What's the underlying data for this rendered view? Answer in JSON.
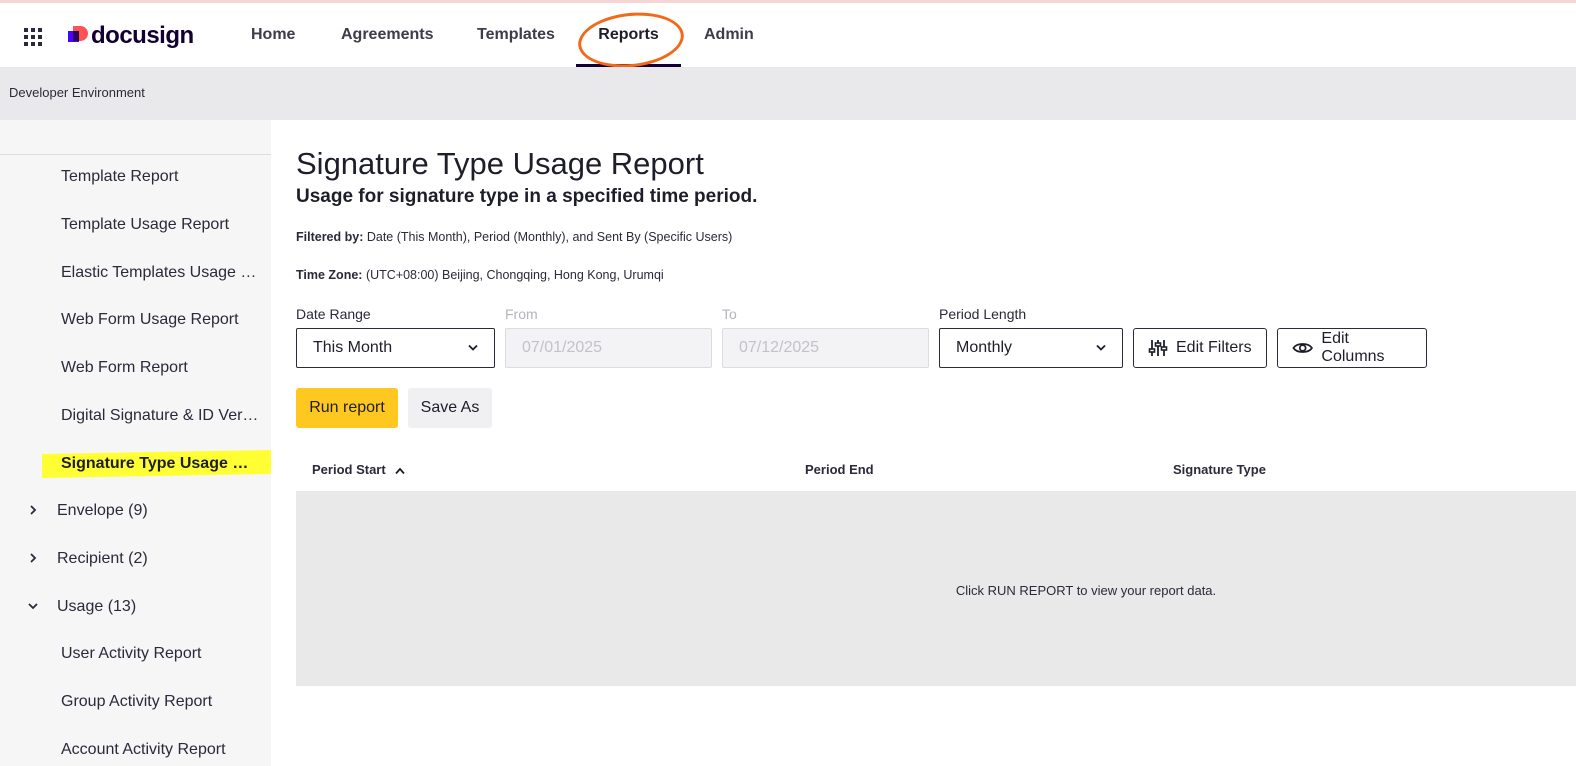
{
  "header": {
    "logo_text": "docusign",
    "nav": [
      {
        "label": "Home"
      },
      {
        "label": "Agreements"
      },
      {
        "label": "Templates"
      },
      {
        "label": "Reports"
      },
      {
        "label": "Admin"
      }
    ],
    "active_nav": "Reports"
  },
  "environment_label": "Developer Environment",
  "sidebar": {
    "items": [
      {
        "label": "Template Report"
      },
      {
        "label": "Template Usage Report"
      },
      {
        "label": "Elastic Templates Usage R..."
      },
      {
        "label": "Web Form Usage Report"
      },
      {
        "label": "Web Form Report"
      },
      {
        "label": "Digital Signature & ID Veri..."
      },
      {
        "label": "Signature Type Usage Re..."
      }
    ],
    "groups": [
      {
        "label": "Envelope (9)",
        "expanded": false
      },
      {
        "label": "Recipient (2)",
        "expanded": false
      },
      {
        "label": "Usage (13)",
        "expanded": true
      }
    ],
    "usage_items": [
      {
        "label": "User Activity Report"
      },
      {
        "label": "Group Activity Report"
      },
      {
        "label": "Account Activity Report"
      }
    ]
  },
  "report": {
    "title": "Signature Type Usage Report",
    "subtitle": "Usage for signature type in a specified time period.",
    "filtered_by_label": "Filtered by:",
    "filtered_by_value": "Date (This Month), Period (Monthly), and Sent By (Specific Users)",
    "timezone_label": "Time Zone:",
    "timezone_value": "(UTC+08:00) Beijing, Chongqing, Hong Kong, Urumqi"
  },
  "filters": {
    "date_range_label": "Date Range",
    "date_range_value": "This Month",
    "from_label": "From",
    "from_value": "07/01/2025",
    "to_label": "To",
    "to_value": "07/12/2025",
    "period_length_label": "Period Length",
    "period_length_value": "Monthly",
    "edit_filters_label": "Edit Filters",
    "edit_columns_label": "Edit Columns"
  },
  "actions": {
    "run_report_label": "Run report",
    "save_as_label": "Save As"
  },
  "table": {
    "columns": [
      "Period Start",
      "Period End",
      "Signature Type"
    ],
    "empty_message": "Click RUN REPORT to view your report data."
  },
  "colors": {
    "accent_yellow": "#ffc820",
    "highlight": "#ffff33",
    "annotation_orange": "#f06a1a",
    "brand_purple": "#4c00ff",
    "brand_coral": "#ff5252"
  }
}
